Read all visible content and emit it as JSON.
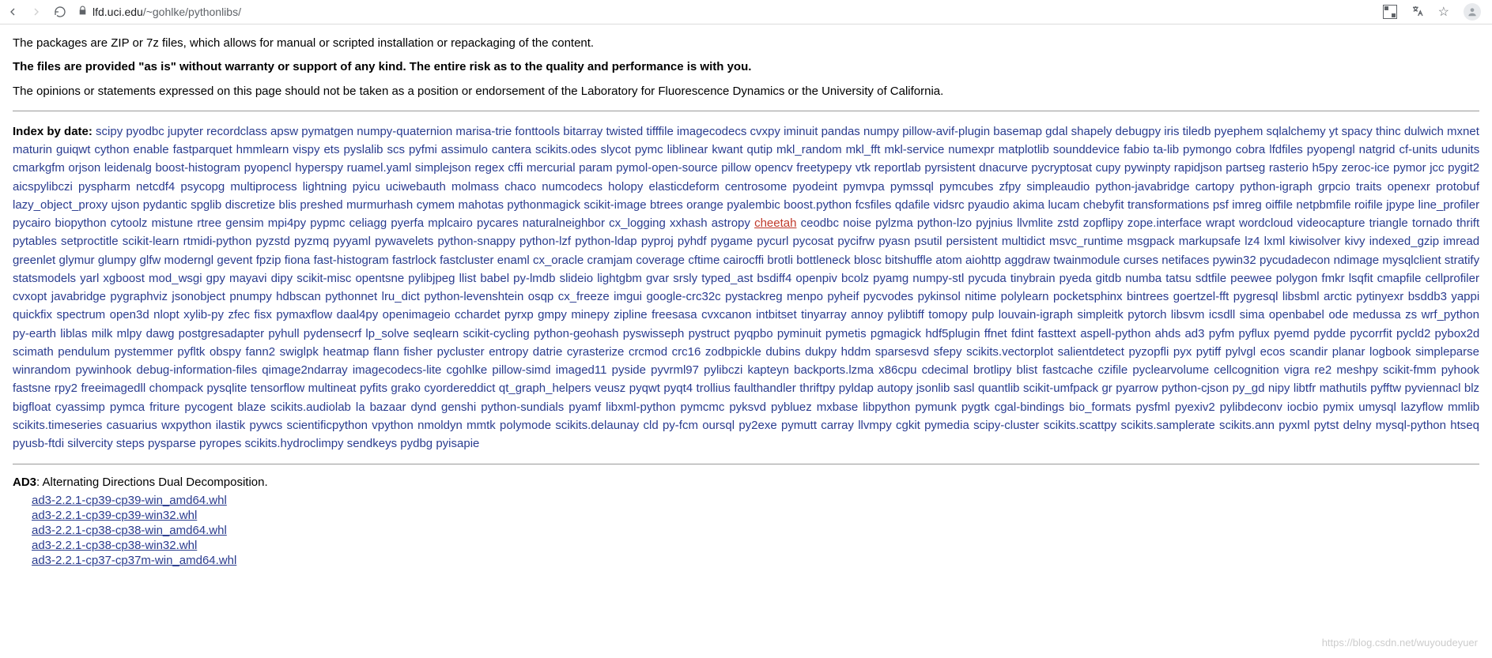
{
  "browser": {
    "url_host": "lfd.uci.edu",
    "url_path": "/~gohlke/pythonlibs/"
  },
  "intro": {
    "p1": "The packages are ZIP or 7z files, which allows for manual or scripted installation or repackaging of the content.",
    "p2": "The files are provided \"as is\" without warranty or support of any kind. The entire risk as to the quality and performance is with you.",
    "p3": "The opinions or statements expressed on this page should not be taken as a position or endorsement of the Laboratory for Fluorescence Dynamics or the University of California."
  },
  "index_title": "Index by date:",
  "packages": [
    "scipy",
    "pyodbc",
    "jupyter",
    "recordclass",
    "apsw",
    "pymatgen",
    "numpy-quaternion",
    "marisa-trie",
    "fonttools",
    "bitarray",
    "twisted",
    "tifffile",
    "imagecodecs",
    "cvxpy",
    "iminuit",
    "pandas",
    "numpy",
    "pillow-avif-plugin",
    "basemap",
    "gdal",
    "shapely",
    "debugpy",
    "iris",
    "tiledb",
    "pyephem",
    "sqlalchemy",
    "yt",
    "spacy",
    "thinc",
    "dulwich",
    "mxnet",
    "maturin",
    "guiqwt",
    "cython",
    "enable",
    "fastparquet",
    "hmmlearn",
    "vispy",
    "ets",
    "pyslalib",
    "scs",
    "pyfmi",
    "assimulo",
    "cantera",
    "scikits.odes",
    "slycot",
    "pymc",
    "liblinear",
    "kwant",
    "qutip",
    "mkl_random",
    "mkl_fft",
    "mkl-service",
    "numexpr",
    "matplotlib",
    "sounddevice",
    "fabio",
    "ta-lib",
    "pymongo",
    "cobra",
    "lfdfiles",
    "pyopengl",
    "natgrid",
    "cf-units",
    "udunits",
    "cmarkgfm",
    "orjson",
    "leidenalg",
    "boost-histogram",
    "pyopencl",
    "hyperspy",
    "ruamel.yaml",
    "simplejson",
    "regex",
    "cffi",
    "mercurial",
    "param",
    "pymol-open-source",
    "pillow",
    "opencv",
    "freetypepy",
    "vtk",
    "reportlab",
    "pyrsistent",
    "dnacurve",
    "pycryptosat",
    "cupy",
    "pywinpty",
    "rapidjson",
    "partseg",
    "rasterio",
    "h5py",
    "zeroc-ice",
    "pymor",
    "jcc",
    "pygit2",
    "aicspylibczi",
    "pyspharm",
    "netcdf4",
    "psycopg",
    "multiprocess",
    "lightning",
    "pyicu",
    "uciwebauth",
    "molmass",
    "chaco",
    "numcodecs",
    "holopy",
    "elasticdeform",
    "centrosome",
    "pyodeint",
    "pymvpa",
    "pymssql",
    "pymcubes",
    "zfpy",
    "simpleaudio",
    "python-javabridge",
    "cartopy",
    "python-igraph",
    "grpcio",
    "traits",
    "openexr",
    "protobuf",
    "lazy_object_proxy",
    "ujson",
    "pydantic",
    "spglib",
    "discretize",
    "blis",
    "preshed",
    "murmurhash",
    "cymem",
    "mahotas",
    "pythonmagick",
    "scikit-image",
    "btrees",
    "orange",
    "pyalembic",
    "boost.python",
    "fcsfiles",
    "qdafile",
    "vidsrc",
    "pyaudio",
    "akima",
    "lucam",
    "chebyfit",
    "transformations",
    "psf",
    "imreg",
    "oiffile",
    "netpbmfile",
    "roifile",
    "jpype",
    "line_profiler",
    "pycairo",
    "biopython",
    "cytoolz",
    "mistune",
    "rtree",
    "gensim",
    "mpi4py",
    "pypmc",
    "celiagg",
    "pyerfa",
    "mplcairo",
    "pycares",
    "naturalneighbor",
    "cx_logging",
    "xxhash",
    "astropy",
    "cheetah",
    "ceodbc",
    "noise",
    "pylzma",
    "python-lzo",
    "pyjnius",
    "llvmlite",
    "zstd",
    "zopflipy",
    "zope.interface",
    "wrapt",
    "wordcloud",
    "videocapture",
    "triangle",
    "tornado",
    "thrift",
    "pytables",
    "setproctitle",
    "scikit-learn",
    "rtmidi-python",
    "pyzstd",
    "pyzmq",
    "pyyaml",
    "pywavelets",
    "python-snappy",
    "python-lzf",
    "python-ldap",
    "pyproj",
    "pyhdf",
    "pygame",
    "pycurl",
    "pycosat",
    "pycifrw",
    "pyasn",
    "psutil",
    "persistent",
    "multidict",
    "msvc_runtime",
    "msgpack",
    "markupsafe",
    "lz4",
    "lxml",
    "kiwisolver",
    "kivy",
    "indexed_gzip",
    "imread",
    "greenlet",
    "glymur",
    "glumpy",
    "glfw",
    "moderngl",
    "gevent",
    "fpzip",
    "fiona",
    "fast-histogram",
    "fastrlock",
    "fastcluster",
    "enaml",
    "cx_oracle",
    "cramjam",
    "coverage",
    "cftime",
    "cairocffi",
    "brotli",
    "bottleneck",
    "blosc",
    "bitshuffle",
    "atom",
    "aiohttp",
    "aggdraw",
    "twainmodule",
    "curses",
    "netifaces",
    "pywin32",
    "pycudadecon",
    "ndimage",
    "mysqlclient",
    "stratify",
    "statsmodels",
    "yarl",
    "xgboost",
    "mod_wsgi",
    "gpy",
    "mayavi",
    "dipy",
    "scikit-misc",
    "opentsne",
    "pylibjpeg",
    "llist",
    "babel",
    "py-lmdb",
    "slideio",
    "lightgbm",
    "gvar",
    "srsly",
    "typed_ast",
    "bsdiff4",
    "openpiv",
    "bcolz",
    "pyamg",
    "numpy-stl",
    "pycuda",
    "tinybrain",
    "pyeda",
    "gitdb",
    "numba",
    "tatsu",
    "sdtfile",
    "peewee",
    "polygon",
    "fmkr",
    "lsqfit",
    "cmapfile",
    "cellprofiler",
    "cvxopt",
    "javabridge",
    "pygraphviz",
    "jsonobject",
    "pnumpy",
    "hdbscan",
    "pythonnet",
    "lru_dict",
    "python-levenshtein",
    "osqp",
    "cx_freeze",
    "imgui",
    "google-crc32c",
    "pystackreg",
    "menpo",
    "pyheif",
    "pycvodes",
    "pykinsol",
    "nitime",
    "polylearn",
    "pocketsphinx",
    "bintrees",
    "goertzel-fft",
    "pygresql",
    "libsbml",
    "arctic",
    "pytinyexr",
    "bsddb3",
    "yappi",
    "quickfix",
    "spectrum",
    "open3d",
    "nlopt",
    "xylib-py",
    "zfec",
    "fisx",
    "pymaxflow",
    "daal4py",
    "openimageio",
    "cchardet",
    "pyrxp",
    "gmpy",
    "minepy",
    "zipline",
    "freesasa",
    "cvxcanon",
    "intbitset",
    "tinyarray",
    "annoy",
    "pylibtiff",
    "tomopy",
    "pulp",
    "louvain-igraph",
    "simpleitk",
    "pytorch",
    "libsvm",
    "icsdll",
    "sima",
    "openbabel",
    "ode",
    "medussa",
    "zs",
    "wrf_python",
    "py-earth",
    "liblas",
    "milk",
    "mlpy",
    "dawg",
    "postgresadapter",
    "pyhull",
    "pydensecrf",
    "lp_solve",
    "seqlearn",
    "scikit-cycling",
    "python-geohash",
    "pyswisseph",
    "pystruct",
    "pyqpbo",
    "pyminuit",
    "pymetis",
    "pgmagick",
    "hdf5plugin",
    "ffnet",
    "fdint",
    "fasttext",
    "aspell-python",
    "ahds",
    "ad3",
    "pyfm",
    "pyflux",
    "pyemd",
    "pydde",
    "pycorrfit",
    "pycld2",
    "pybox2d",
    "scimath",
    "pendulum",
    "pystemmer",
    "pyfltk",
    "obspy",
    "fann2",
    "swiglpk",
    "heatmap",
    "flann",
    "fisher",
    "pycluster",
    "entropy",
    "datrie",
    "cyrasterize",
    "crcmod",
    "crc16",
    "zodbpickle",
    "dubins",
    "dukpy",
    "hddm",
    "sparsesvd",
    "sfepy",
    "scikits.vectorplot",
    "salientdetect",
    "pyzopfli",
    "pyx",
    "pytiff",
    "pylvgl",
    "ecos",
    "scandir",
    "planar",
    "logbook",
    "simpleparse",
    "winrandom",
    "pywinhook",
    "debug-information-files",
    "qimage2ndarray",
    "imagecodecs-lite",
    "cgohlke",
    "pillow-simd",
    "imaged11",
    "pyside",
    "pyvrml97",
    "pylibczi",
    "kapteyn",
    "backports.lzma",
    "x86cpu",
    "cdecimal",
    "brotlipy",
    "blist",
    "fastcache",
    "czifile",
    "pyclearvolume",
    "cellcognition",
    "vigra",
    "re2",
    "meshpy",
    "scikit-fmm",
    "pyhook",
    "fastsne",
    "rpy2",
    "freeimagedll",
    "chompack",
    "pysqlite",
    "tensorflow",
    "multineat",
    "pyfits",
    "grako",
    "cyordereddict",
    "qt_graph_helpers",
    "veusz",
    "pyqwt",
    "pyqt4",
    "trollius",
    "faulthandler",
    "thriftpy",
    "pyldap",
    "autopy",
    "jsonlib",
    "sasl",
    "quantlib",
    "scikit-umfpack",
    "gr",
    "pyarrow",
    "python-cjson",
    "py_gd",
    "nipy",
    "libtfr",
    "mathutils",
    "pyfftw",
    "pyviennacl",
    "blz",
    "bigfloat",
    "cyassimp",
    "pymca",
    "friture",
    "pycogent",
    "blaze",
    "scikits.audiolab",
    "la",
    "bazaar",
    "dynd",
    "genshi",
    "python-sundials",
    "pyamf",
    "libxml-python",
    "pymcmc",
    "pyksvd",
    "pybluez",
    "mxbase",
    "libpython",
    "pymunk",
    "pygtk",
    "cgal-bindings",
    "bio_formats",
    "pysfml",
    "pyexiv2",
    "pylibdeconv",
    "iocbio",
    "pymix",
    "umysql",
    "lazyflow",
    "mmlib",
    "scikits.timeseries",
    "casuarius",
    "wxpython",
    "ilastik",
    "pywcs",
    "scientificpython",
    "vpython",
    "nmoldyn",
    "mmtk",
    "polymode",
    "scikits.delaunay",
    "cld",
    "py-fcm",
    "oursql",
    "py2exe",
    "pymutt",
    "carray",
    "llvmpy",
    "cgkit",
    "pymedia",
    "scipy-cluster",
    "scikits.scattpy",
    "scikits.samplerate",
    "scikits.ann",
    "pyxml",
    "pytst",
    "delny",
    "mysql-python",
    "htseq",
    "pyusb-ftdi",
    "silvercity",
    "steps",
    "pysparse",
    "pyropes",
    "scikits.hydroclimpy",
    "sendkeys",
    "pydbg",
    "pyisapie"
  ],
  "highlight_package": "cheetah",
  "ad3": {
    "title": "AD3",
    "desc": ": Alternating Directions Dual Decomposition.",
    "wheels": [
      "ad3-2.2.1-cp39-cp39-win_amd64.whl",
      "ad3-2.2.1-cp39-cp39-win32.whl",
      "ad3-2.2.1-cp38-cp38-win_amd64.whl",
      "ad3-2.2.1-cp38-cp38-win32.whl",
      "ad3-2.2.1-cp37-cp37m-win_amd64.whl"
    ]
  },
  "watermark": "https://blog.csdn.net/wuyoudeyuer"
}
